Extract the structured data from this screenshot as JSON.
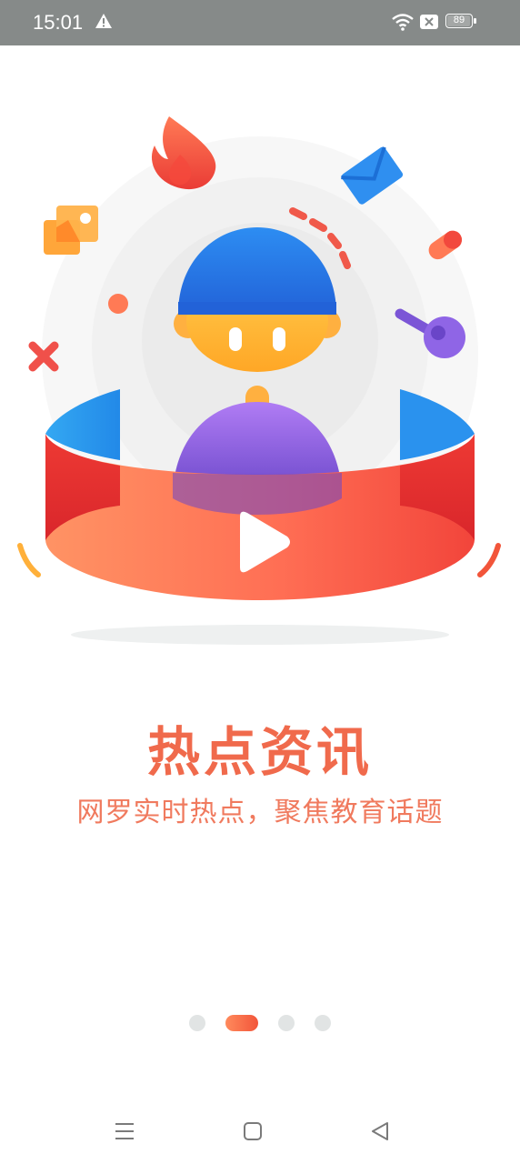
{
  "status_bar": {
    "time": "15:01",
    "battery_level": "89",
    "icons": [
      "warning-icon",
      "wifi-icon",
      "sim-off-icon",
      "battery-icon"
    ]
  },
  "onboarding": {
    "title": "热点资讯",
    "subtitle": "网罗实时热点，聚焦教育话题",
    "pages_total": 4,
    "active_page_index": 1
  },
  "nav_bar": {
    "buttons": [
      "menu-icon",
      "home-icon",
      "back-icon"
    ]
  },
  "colors": {
    "accent": "#f06a4c",
    "status_bar_bg": "#868a89",
    "dot_inactive": "#e1e4e4"
  }
}
